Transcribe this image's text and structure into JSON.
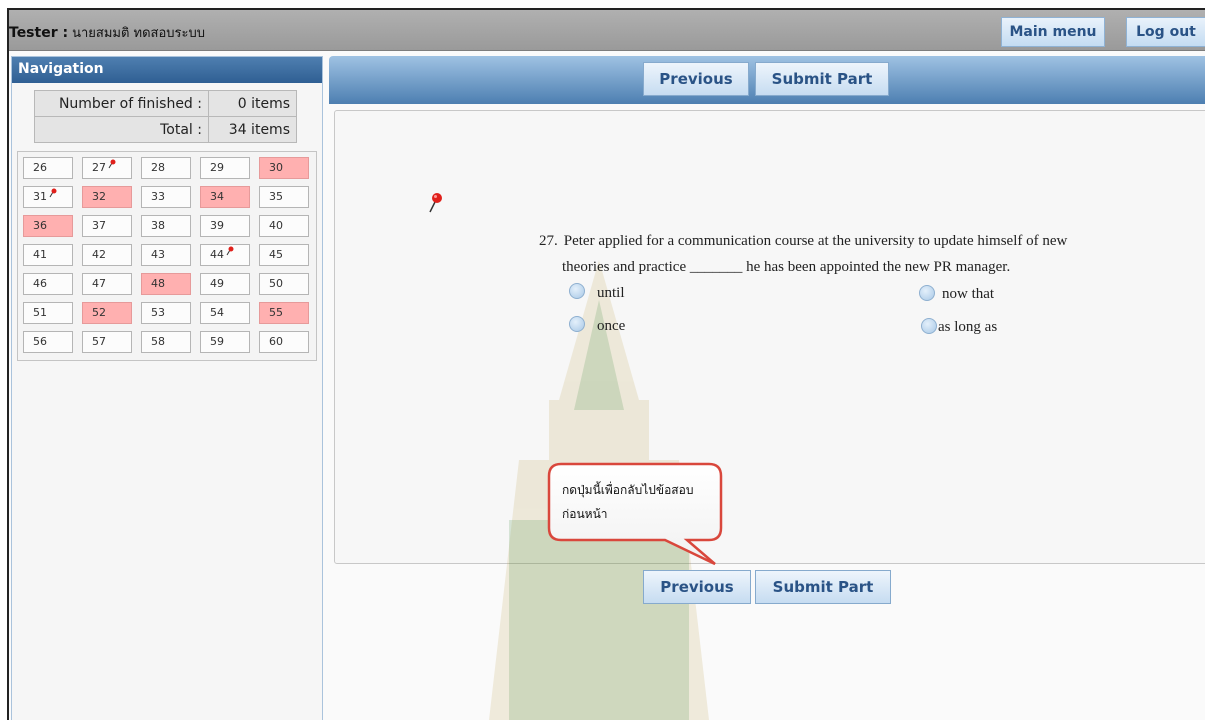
{
  "header": {
    "tester_label": "Tester :",
    "tester_name": "นายสมมติ ทดสอบระบบ",
    "main_menu": "Main menu",
    "log_out": "Log out"
  },
  "navigation": {
    "title": "Navigation",
    "finished_label": "Number of finished :",
    "finished_value": "0 items",
    "total_label": "Total :",
    "total_value": "34 items",
    "questions": [
      {
        "n": "26",
        "answered": false,
        "flag": false
      },
      {
        "n": "27",
        "answered": false,
        "flag": true
      },
      {
        "n": "28",
        "answered": false,
        "flag": false
      },
      {
        "n": "29",
        "answered": false,
        "flag": false
      },
      {
        "n": "30",
        "answered": true,
        "flag": false
      },
      {
        "n": "31",
        "answered": false,
        "flag": true
      },
      {
        "n": "32",
        "answered": true,
        "flag": false
      },
      {
        "n": "33",
        "answered": false,
        "flag": false
      },
      {
        "n": "34",
        "answered": true,
        "flag": false
      },
      {
        "n": "35",
        "answered": false,
        "flag": false
      },
      {
        "n": "36",
        "answered": true,
        "flag": false
      },
      {
        "n": "37",
        "answered": false,
        "flag": false
      },
      {
        "n": "38",
        "answered": false,
        "flag": false
      },
      {
        "n": "39",
        "answered": false,
        "flag": false
      },
      {
        "n": "40",
        "answered": false,
        "flag": false
      },
      {
        "n": "41",
        "answered": false,
        "flag": false
      },
      {
        "n": "42",
        "answered": false,
        "flag": false
      },
      {
        "n": "43",
        "answered": false,
        "flag": false
      },
      {
        "n": "44",
        "answered": false,
        "flag": true
      },
      {
        "n": "45",
        "answered": false,
        "flag": false
      },
      {
        "n": "46",
        "answered": false,
        "flag": false
      },
      {
        "n": "47",
        "answered": false,
        "flag": false
      },
      {
        "n": "48",
        "answered": true,
        "flag": false
      },
      {
        "n": "49",
        "answered": false,
        "flag": false
      },
      {
        "n": "50",
        "answered": false,
        "flag": false
      },
      {
        "n": "51",
        "answered": false,
        "flag": false
      },
      {
        "n": "52",
        "answered": true,
        "flag": false
      },
      {
        "n": "53",
        "answered": false,
        "flag": false
      },
      {
        "n": "54",
        "answered": false,
        "flag": false
      },
      {
        "n": "55",
        "answered": true,
        "flag": false
      },
      {
        "n": "56",
        "answered": false,
        "flag": false
      },
      {
        "n": "57",
        "answered": false,
        "flag": false
      },
      {
        "n": "58",
        "answered": false,
        "flag": false
      },
      {
        "n": "59",
        "answered": false,
        "flag": false
      },
      {
        "n": "60",
        "answered": false,
        "flag": false
      }
    ]
  },
  "buttons": {
    "previous": "Previous",
    "submit_part": "Submit Part"
  },
  "question": {
    "number": "27.",
    "line1": "Peter applied for a communication course at the university to update himself of new",
    "line2": "theories and practice _______ he has been appointed the new PR manager.",
    "options": [
      "until",
      "now that",
      "once",
      "as long as"
    ]
  },
  "callout": {
    "line1": "กดปุ่มนี้เพื่อกลับไปข้อสอบ",
    "line2": "ก่อนหน้า"
  },
  "colors": {
    "answered_cell": "#ffb0b0",
    "button_text": "#2a5386",
    "header_blue": "#4d7fb1",
    "callout_border": "#d9473c"
  }
}
